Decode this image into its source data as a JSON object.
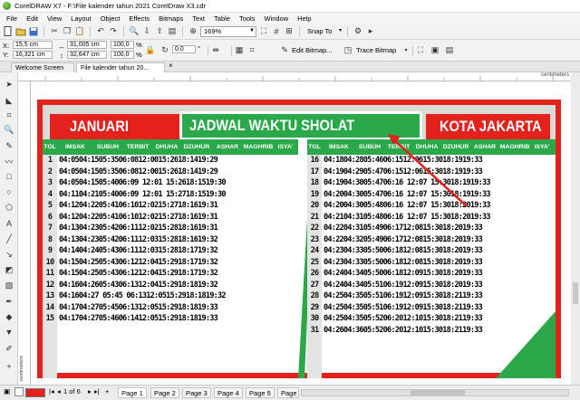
{
  "window": {
    "title": "CorelDRAW X7 - F:\\File kalender tahun 2021 CorelDraw X3.cdr"
  },
  "menu": [
    "File",
    "Edit",
    "View",
    "Layout",
    "Object",
    "Effects",
    "Bitmaps",
    "Text",
    "Table",
    "Tools",
    "Window",
    "Help"
  ],
  "toolbar": {
    "zoom": "169%",
    "snap_label": "Snap To",
    "snap_arrow": "▾"
  },
  "properties": {
    "x_label": "X:",
    "x": "15,5 cm",
    "y_label": "Y:",
    "y": "16,321 cm",
    "width": "31,005 cm",
    "height": "32,647 cm",
    "scale_w": "100,0",
    "scale_h": "100,0",
    "pct": "%",
    "angle": "0,0",
    "angle_unit": "°",
    "edit_bitmap": "Edit Bitmap...",
    "trace_bitmap": "Trace Bitmap"
  },
  "doc_tabs": [
    "Welcome Screen",
    "File kalender tahun 20..."
  ],
  "ruler": {
    "unit": "centimeters"
  },
  "statusbar": {
    "page_count": "1 of 6",
    "pages": [
      "Page 1",
      "Page 2",
      "Page 3",
      "Page 4",
      "Page 5",
      "Page 6"
    ]
  },
  "poster": {
    "month": "JANUARI",
    "title": "JADWAL WAKTU SHOLAT",
    "city": "KOTA JAKARTA",
    "columns": [
      "TGL",
      "IMSAK",
      "SUBUH",
      "TERBIT",
      "DHUHA",
      "DZUHUR",
      "ASHAR",
      "MAGHRIB",
      "ISYA'"
    ],
    "left_rows": [
      {
        "tgl": "1",
        "t": "04:0504:1505:3506:0812:0015:2618:1419:29"
      },
      {
        "tgl": "2",
        "t": "04:0504:1505:3506:0812:0015:2618:1419:29"
      },
      {
        "tgl": "3",
        "t": "04:0504:1505:4006:09 12:01 15:2618:1519:30"
      },
      {
        "tgl": "4",
        "t": "04:1104:2105:4006:09 12:01 15:2718:1519:30"
      },
      {
        "tgl": "5",
        "t": "04:1204:2205:4106:1012:0215:2718:1619:31"
      },
      {
        "tgl": "6",
        "t": "04:1204:2205:4106:1012:0215:2718:1619:31"
      },
      {
        "tgl": "7",
        "t": "04:1304:2305:4206:1112:0215:2818:1619:31"
      },
      {
        "tgl": "8",
        "t": "04:1304:2305:4206:1112:0315:2818:1619:32"
      },
      {
        "tgl": "9",
        "t": "04:1404:2405:4306:1112:0315:2818:1719:32"
      },
      {
        "tgl": "10",
        "t": "04:1504:2505:4306:1212:0415:2918:1719:32"
      },
      {
        "tgl": "11",
        "t": "04:1504:2505:4306:1212:0415:2918:1719:32"
      },
      {
        "tgl": "12",
        "t": "04:1604:2605:4306:1312:0415:2918:1819:32"
      },
      {
        "tgl": "13",
        "t": "04:1604:27 05:45 06:1312:0515:2918:1819:32"
      },
      {
        "tgl": "14",
        "t": "04:1704:2705:4506:1312:0515:2918:1819:33"
      },
      {
        "tgl": "15",
        "t": "04:1704:2705:4606:1412:0515:2918:1819:33"
      }
    ],
    "right_rows": [
      {
        "tgl": "16",
        "t": "04:1804:2805:4606:1512:0615:3018:1919:33"
      },
      {
        "tgl": "17",
        "t": "04:1904:2905:4706:1512:0615:3018:1919:33"
      },
      {
        "tgl": "18",
        "t": "04:1904:3005:4706:16 12:07 15:3018:1919:33"
      },
      {
        "tgl": "19",
        "t": "04:2004:3005:4706:16 12:07 15:3018:1919:33"
      },
      {
        "tgl": "20",
        "t": "04:2004:3005:4806:16 12:07 15:3018:2019:33"
      },
      {
        "tgl": "21",
        "t": "04:2104:3105:4806:16 12:07 15:3018:2019:33"
      },
      {
        "tgl": "22",
        "t": "04:2204:3105:4906:1712:0815:3018:2019:33"
      },
      {
        "tgl": "23",
        "t": "04:2204:3205:4906:1712:0815:3018:2019:33"
      },
      {
        "tgl": "24",
        "t": "04:2304:3305:5006:1812:0815:3018:2019:33"
      },
      {
        "tgl": "25",
        "t": "04:2304:3305:5006:1812:0815:3018:2019:33"
      },
      {
        "tgl": "26",
        "t": "04:2404:3405:5006:1812:0915:3018:2019:33"
      },
      {
        "tgl": "27",
        "t": "04:2404:3405:5106:1912:0915:3018:2019:33"
      },
      {
        "tgl": "28",
        "t": "04:2504:3505:5106:1912:0915:3018:2119:33"
      },
      {
        "tgl": "29",
        "t": "04:2504:3505:5106:1912:0915:3018:2119:33"
      },
      {
        "tgl": "30",
        "t": "04:2504:3505:5206:2012:1015:3018:2119:33"
      },
      {
        "tgl": "31",
        "t": "04:2604:3605:5206:2012:1015:3018:2119:33"
      }
    ]
  }
}
